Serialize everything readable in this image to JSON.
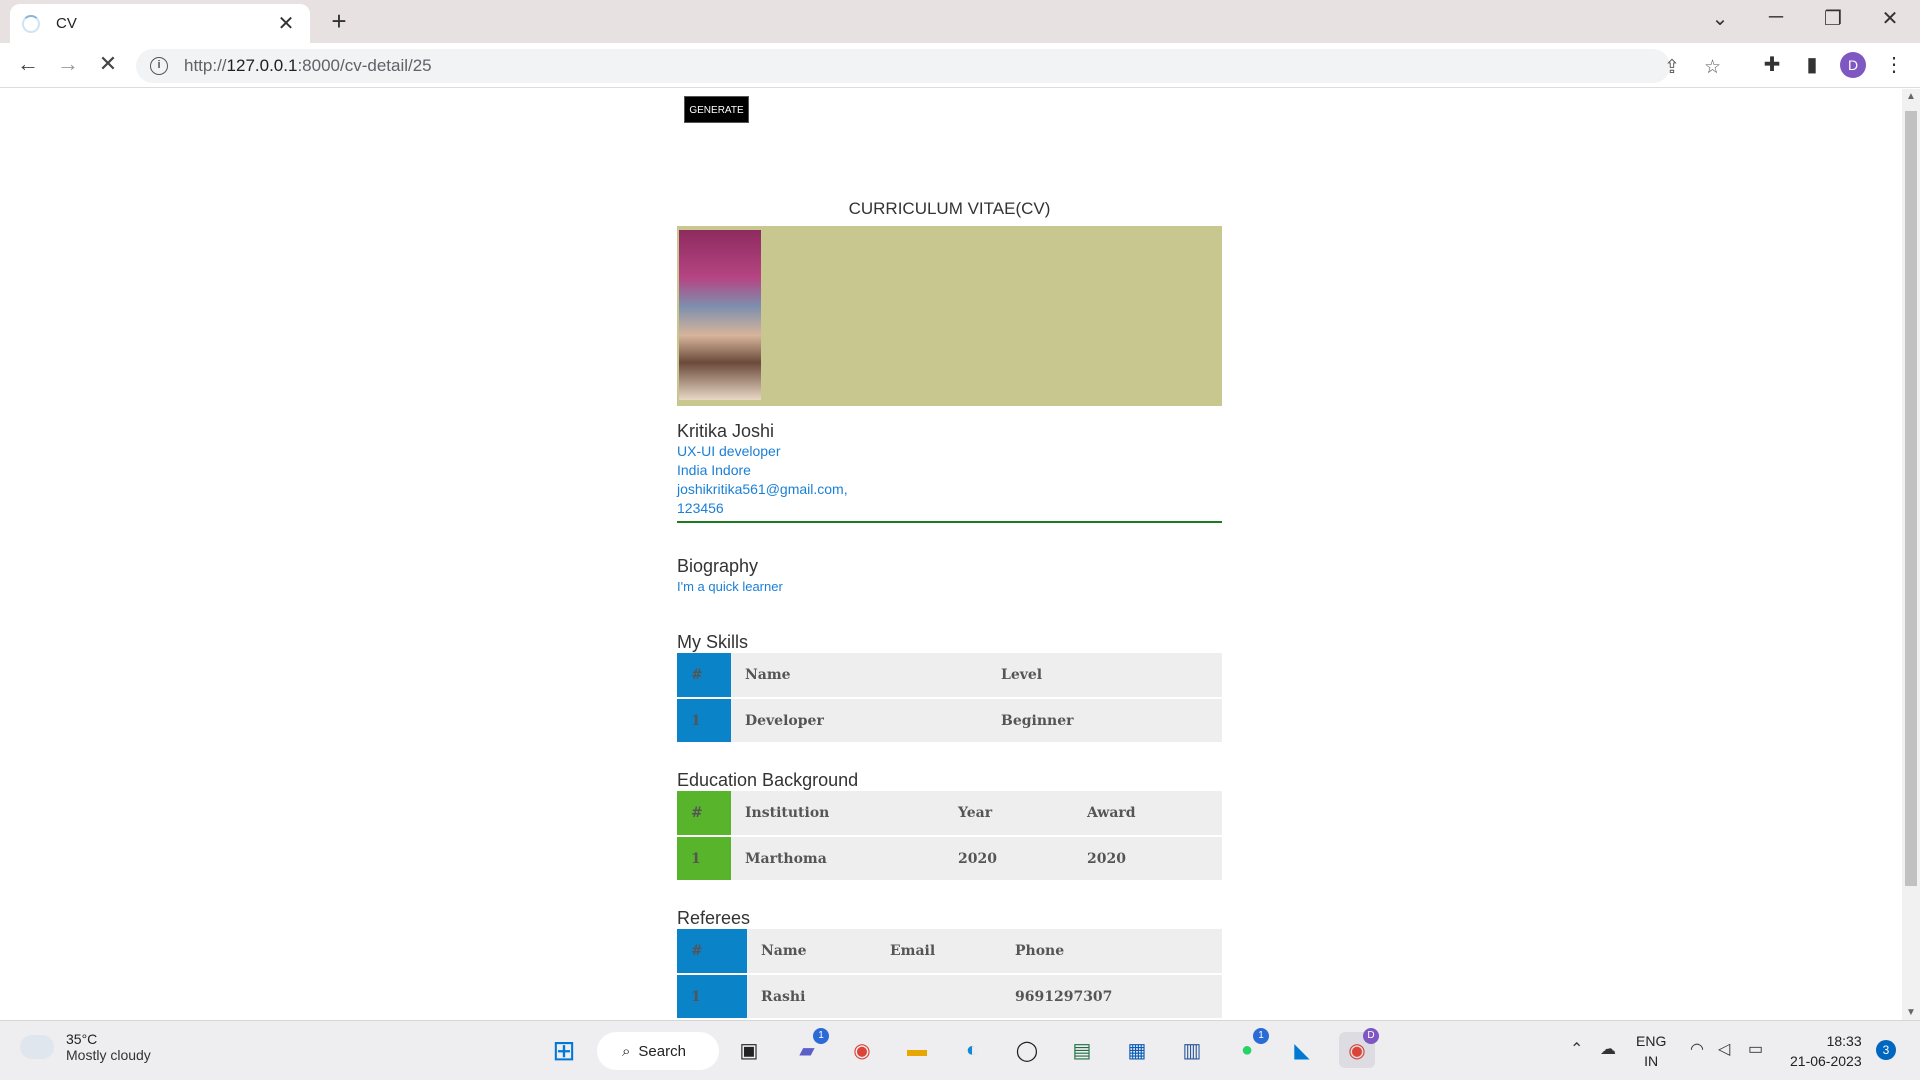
{
  "browser": {
    "tab_title": "CV",
    "url_prefix": "http://",
    "url_host": "127.0.0.1",
    "url_path": ":8000/cv-detail/25",
    "profile_initial": "D"
  },
  "page": {
    "generate_label": "GENERATE",
    "cv_title": "CURRICULUM VITAE(CV)",
    "person": {
      "name": "Kritika Joshi",
      "role": "UX-UI developer",
      "location": "India Indore",
      "email": "joshikritika561@gmail.com,",
      "phone": "123456"
    },
    "biography": {
      "heading": "Biography",
      "text": "I'm a quick learner"
    },
    "skills": {
      "heading": "My Skills",
      "headers": [
        "#",
        "Name",
        "Level"
      ],
      "rows": [
        [
          "1",
          "Developer",
          "Beginner"
        ]
      ]
    },
    "education": {
      "heading": "Education Background",
      "headers": [
        "#",
        "Institution",
        "Year",
        "Award"
      ],
      "rows": [
        [
          "1",
          "Marthoma",
          "2020",
          "2020"
        ]
      ]
    },
    "referees": {
      "heading": "Referees",
      "headers": [
        "#",
        "Name",
        "Email",
        "Phone"
      ],
      "rows": [
        [
          "1",
          "Rashi",
          "",
          "9691297307"
        ]
      ]
    }
  },
  "taskbar": {
    "temperature": "35°C",
    "weather": "Mostly cloudy",
    "search_label": "Search",
    "lang_1": "ENG",
    "lang_2": "IN",
    "time": "18:33",
    "date": "21-06-2023",
    "notification_count": "3",
    "teams_badge": "1",
    "whatsapp_badge": "1",
    "chrome_badge": "D"
  },
  "colors": {
    "skills_accent": "#0a83c8",
    "education_accent": "#58b42a",
    "referees_accent": "#0a83c8",
    "photo_band": "#c7c78f",
    "divider": "#1e7a1e",
    "link_text": "#1a7fd6"
  }
}
